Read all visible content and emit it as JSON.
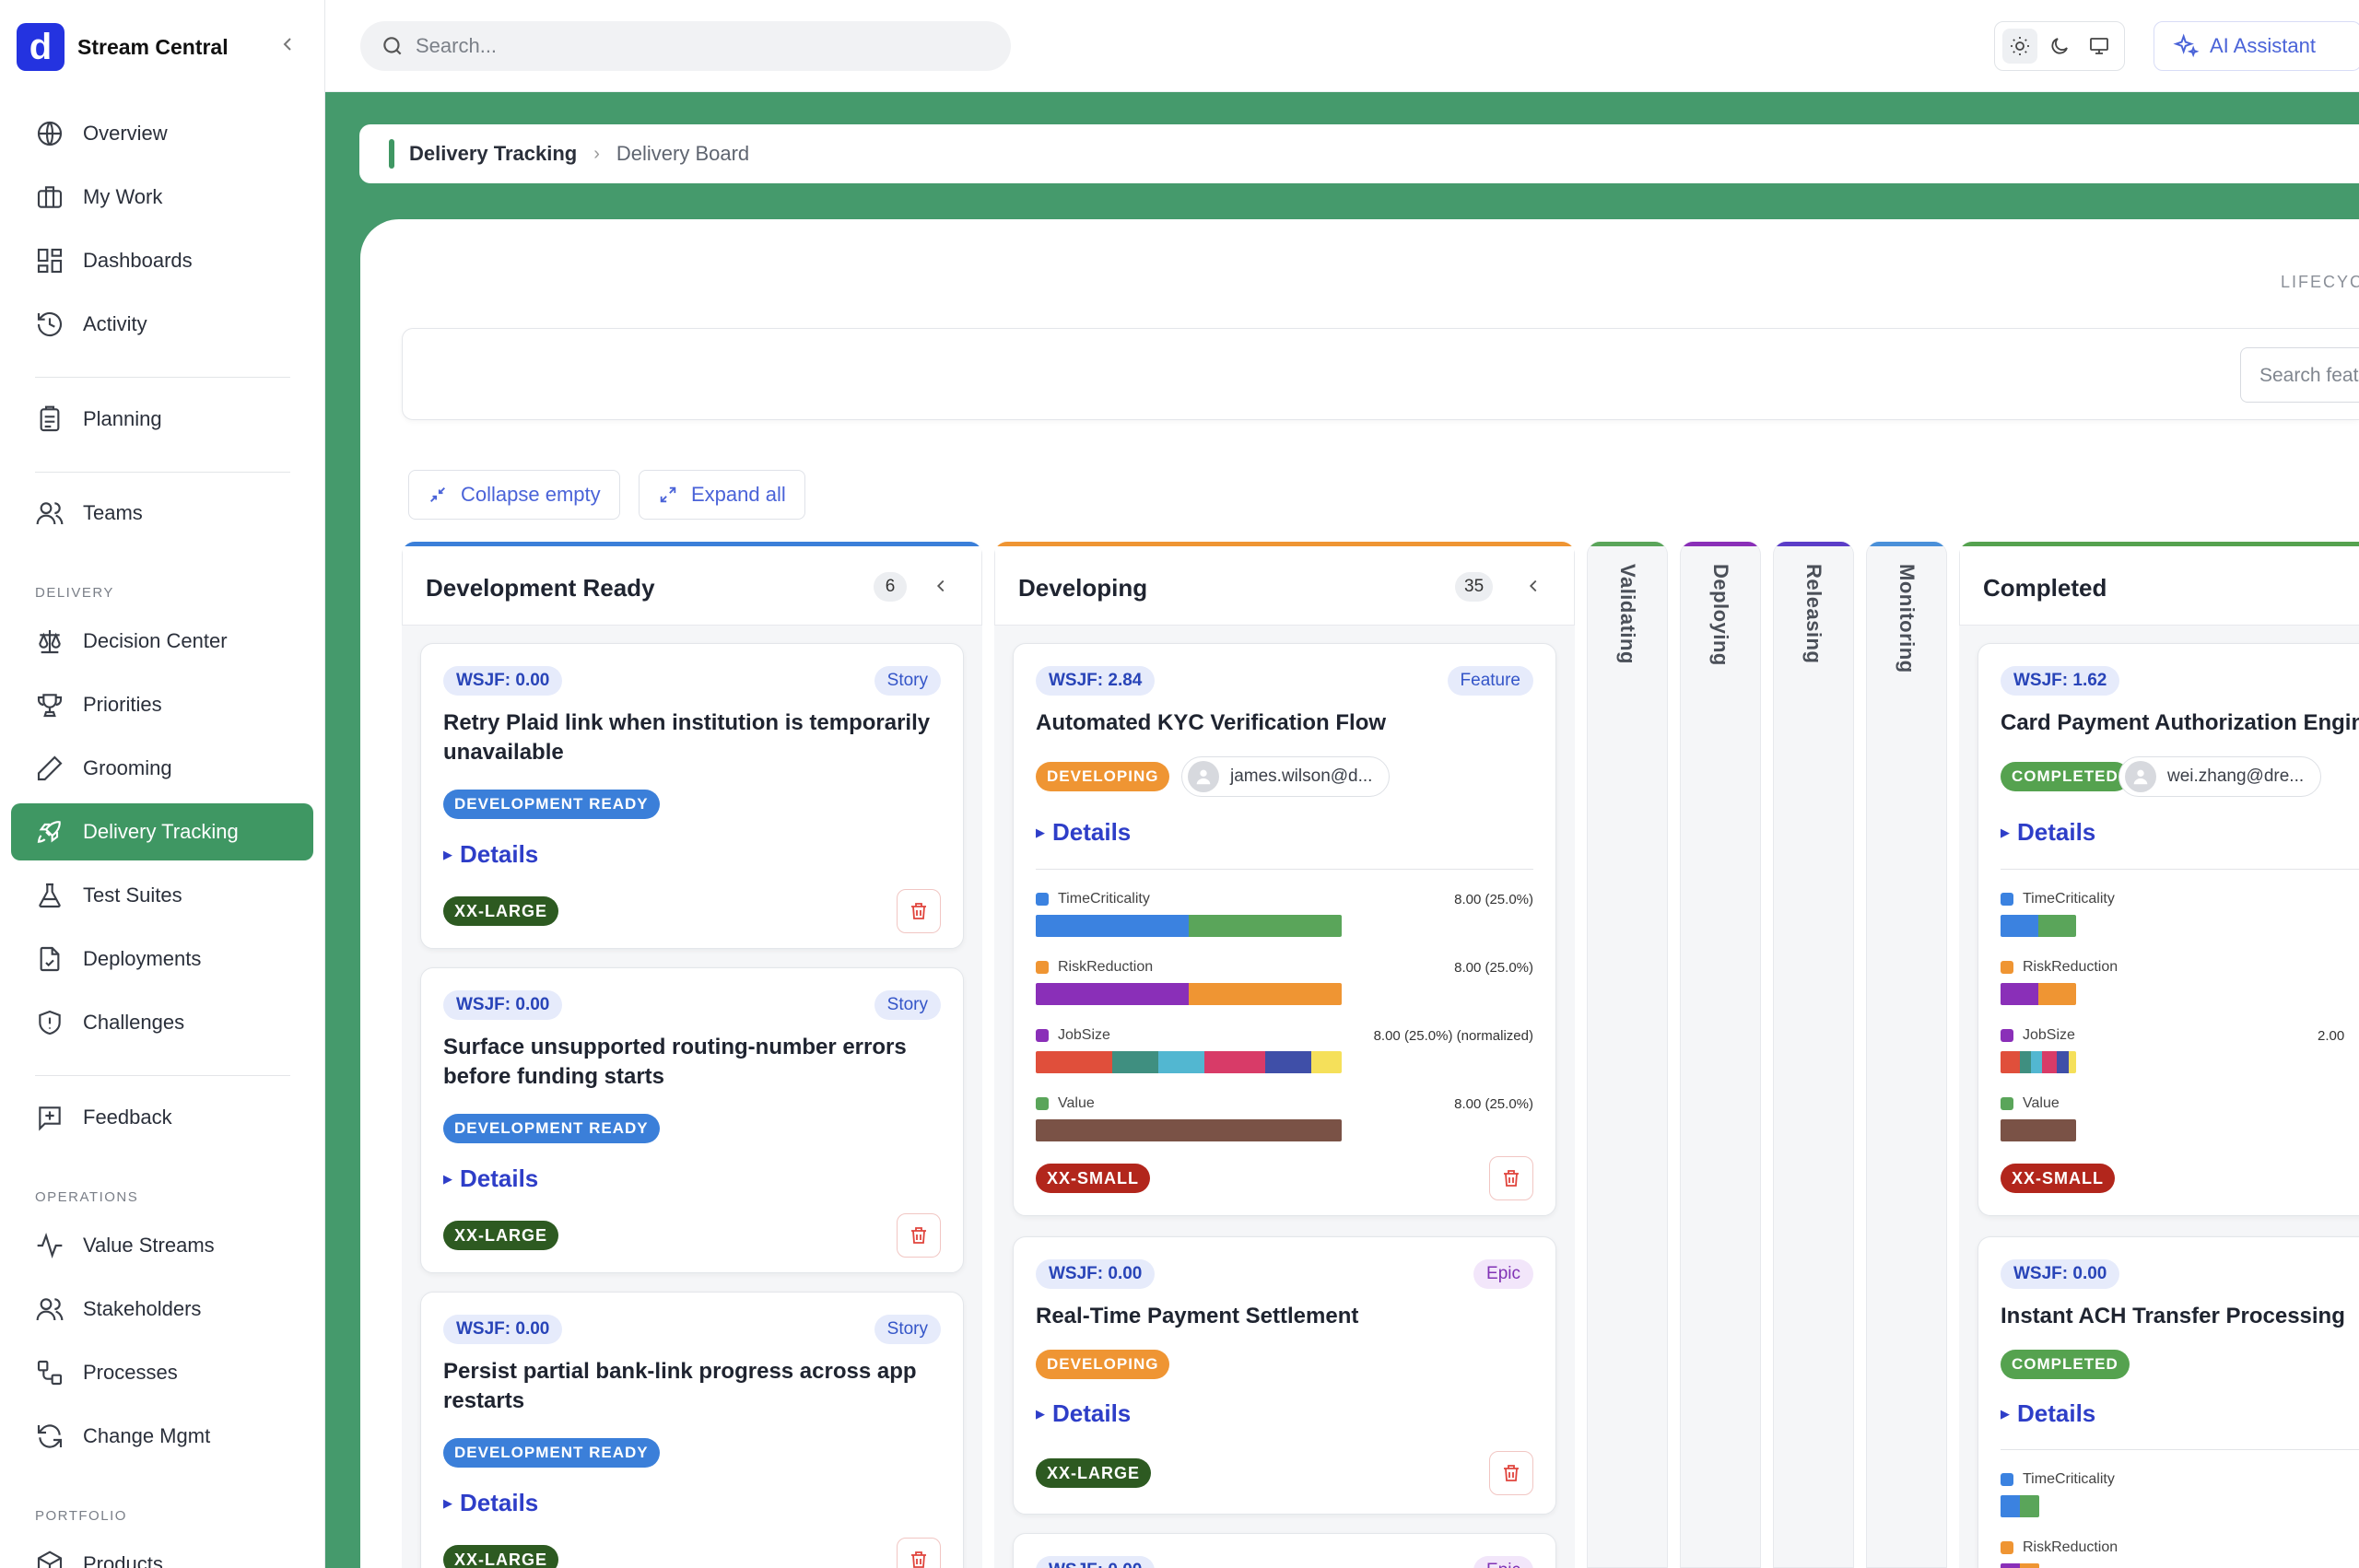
{
  "app": {
    "name": "Stream Central",
    "logo_letter": "d"
  },
  "sidebar": {
    "items": [
      {
        "label": "Overview",
        "icon": "globe-icon"
      },
      {
        "label": "My Work",
        "icon": "briefcase-icon"
      },
      {
        "label": "Dashboards",
        "icon": "dashboard-icon"
      },
      {
        "label": "Activity",
        "icon": "history-icon"
      },
      {
        "label": "Planning",
        "icon": "clipboard-icon"
      },
      {
        "label": "Teams",
        "icon": "users-icon"
      },
      {
        "label": "Decision Center",
        "icon": "scale-icon"
      },
      {
        "label": "Priorities",
        "icon": "trophy-icon"
      },
      {
        "label": "Grooming",
        "icon": "pen-icon"
      },
      {
        "label": "Delivery Tracking",
        "icon": "rocket-icon",
        "active": true
      },
      {
        "label": "Test Suites",
        "icon": "flask-icon"
      },
      {
        "label": "Deployments",
        "icon": "file-check-icon"
      },
      {
        "label": "Challenges",
        "icon": "shield-alert-icon"
      },
      {
        "label": "Feedback",
        "icon": "message-plus-icon"
      },
      {
        "label": "Value Streams",
        "icon": "activity-icon"
      },
      {
        "label": "Stakeholders",
        "icon": "users-icon"
      },
      {
        "label": "Processes",
        "icon": "workflow-icon"
      },
      {
        "label": "Change Mgmt",
        "icon": "refresh-icon"
      },
      {
        "label": "Products",
        "icon": "package-icon"
      }
    ],
    "sections": {
      "delivery": "DELIVERY",
      "operations": "OPERATIONS",
      "portfolio": "PORTFOLIO"
    }
  },
  "topbar": {
    "search_placeholder": "Search...",
    "theme_options": [
      "light",
      "dark",
      "system"
    ],
    "theme_selected": "light",
    "ai_label": "AI Assistant"
  },
  "breadcrumb": {
    "root": "Delivery Tracking",
    "current": "Delivery Board"
  },
  "board": {
    "lifecycle_label": "LIFECYC",
    "feature_search_placeholder": "Search feat",
    "collapse_empty_label": "Collapse empty",
    "expand_all_label": "Expand all",
    "columns": [
      {
        "title": "Development Ready",
        "count": "6",
        "color": "#3b7fd9"
      },
      {
        "title": "Developing",
        "count": "35",
        "color": "#ef9533"
      },
      {
        "title": "Validating",
        "color": "#5aa55a"
      },
      {
        "title": "Deploying",
        "color": "#8a2fb8"
      },
      {
        "title": "Releasing",
        "color": "#5b3dc8"
      },
      {
        "title": "Monitoring",
        "color": "#4a90d9"
      },
      {
        "title": "Completed",
        "color": "#55a24f"
      }
    ],
    "cards": {
      "dr1": {
        "wsjf": "WSJF: 0.00",
        "type": "Story",
        "title": "Retry Plaid link when institution is temporarily unavailable",
        "status": "DEVELOPMENT READY",
        "details": "Details",
        "size": "XX-LARGE"
      },
      "dr2": {
        "wsjf": "WSJF: 0.00",
        "type": "Story",
        "title": "Surface unsupported routing-number errors before funding starts",
        "status": "DEVELOPMENT READY",
        "details": "Details",
        "size": "XX-LARGE"
      },
      "dr3": {
        "wsjf": "WSJF: 0.00",
        "type": "Story",
        "title": "Persist partial bank-link progress across app restarts",
        "status": "DEVELOPMENT READY",
        "details": "Details",
        "size": "XX-LARGE"
      },
      "dev1": {
        "wsjf": "WSJF: 2.84",
        "type": "Feature",
        "title": "Automated KYC Verification Flow",
        "status": "DEVELOPING",
        "assignee": "james.wilson@d...",
        "details": "Details",
        "size": "XX-SMALL",
        "metrics": [
          {
            "name": "TimeCriticality",
            "value": "8.00 (25.0%)",
            "color": "#3b82e0"
          },
          {
            "name": "RiskReduction",
            "value": "8.00 (25.0%)",
            "color": "#ef9533"
          },
          {
            "name": "JobSize",
            "value": "8.00 (25.0%) (normalized)",
            "color": "#8a2fb8"
          },
          {
            "name": "Value",
            "value": "8.00 (25.0%)",
            "color": "#5aa55a"
          }
        ]
      },
      "dev2": {
        "wsjf": "WSJF: 0.00",
        "type": "Epic",
        "title": "Real-Time Payment Settlement",
        "status": "DEVELOPING",
        "details": "Details",
        "size": "XX-LARGE"
      },
      "dev3": {
        "wsjf": "WSJF: 0.00",
        "type": "Epic"
      },
      "c1": {
        "wsjf": "WSJF: 1.62",
        "title": "Card Payment Authorization Engine",
        "status": "COMPLETED",
        "assignee": "wei.zhang@dre...",
        "details": "Details",
        "size": "XX-SMALL",
        "metrics": [
          {
            "name": "TimeCriticality",
            "color": "#3b82e0"
          },
          {
            "name": "RiskReduction",
            "color": "#ef9533"
          },
          {
            "name": "JobSize",
            "value": "2.00",
            "color": "#8a2fb8"
          },
          {
            "name": "Value",
            "color": "#5aa55a"
          }
        ]
      },
      "c2": {
        "wsjf": "WSJF: 0.00",
        "title": "Instant ACH Transfer Processing",
        "status": "COMPLETED",
        "details": "Details",
        "metrics": [
          {
            "name": "TimeCriticality",
            "color": "#3b82e0"
          },
          {
            "name": "RiskReduction",
            "color": "#ef9533"
          }
        ]
      }
    }
  }
}
